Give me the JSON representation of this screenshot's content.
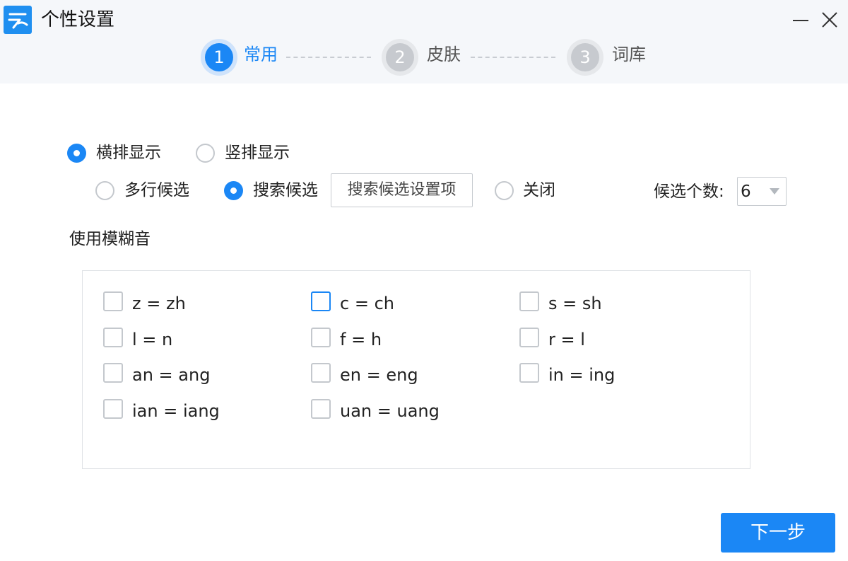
{
  "window": {
    "title": "个性设置",
    "accent": "#1b87f5",
    "icons": {
      "app": "app-logo-icon",
      "minimize": "minimize-icon",
      "close": "close-icon"
    }
  },
  "steps": [
    {
      "number": "1",
      "label": "常用",
      "active": true
    },
    {
      "number": "2",
      "label": "皮肤",
      "active": false
    },
    {
      "number": "3",
      "label": "词库",
      "active": false
    }
  ],
  "layout_mode": {
    "options": [
      {
        "label": "横排显示",
        "checked": true
      },
      {
        "label": "竖排显示",
        "checked": false
      }
    ]
  },
  "candidate_mode": {
    "options": [
      {
        "label": "多行候选",
        "checked": false
      },
      {
        "label": "搜索候选",
        "checked": true
      },
      {
        "label": "关闭",
        "checked": false
      }
    ],
    "settings_button": "搜索候选设置项"
  },
  "candidate_count": {
    "label": "候选个数:",
    "value": "6"
  },
  "fuzzy": {
    "title": "使用模糊音",
    "items": [
      {
        "label": "z = zh",
        "checked": false
      },
      {
        "label": "c = ch",
        "checked": false
      },
      {
        "label": "s = sh",
        "checked": false
      },
      {
        "label": "l = n",
        "checked": false
      },
      {
        "label": "f = h",
        "checked": false
      },
      {
        "label": "r = l",
        "checked": false
      },
      {
        "label": "an = ang",
        "checked": false
      },
      {
        "label": "en = eng",
        "checked": false
      },
      {
        "label": "in = ing",
        "checked": false
      },
      {
        "label": "ian = iang",
        "checked": false
      },
      {
        "label": "uan = uang",
        "checked": false
      }
    ]
  },
  "next_button": "下一步"
}
